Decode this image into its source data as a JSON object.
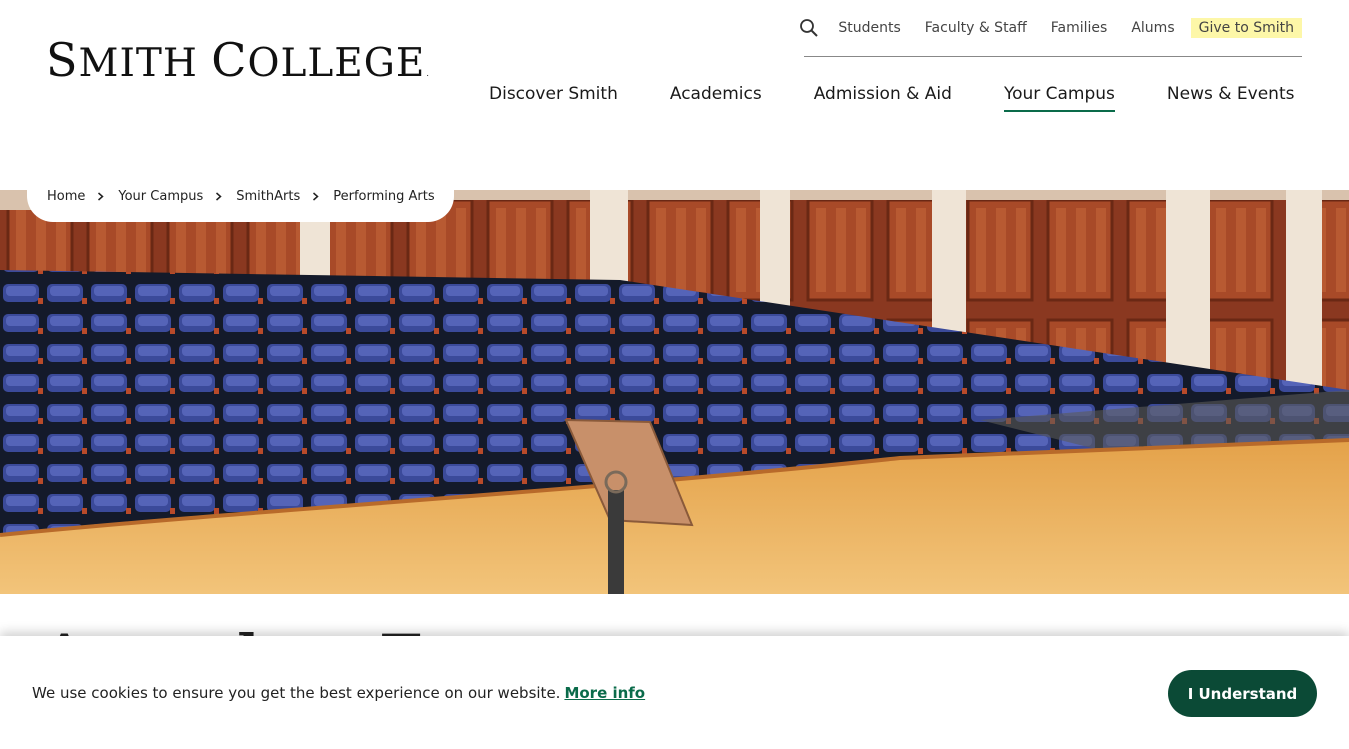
{
  "logo": {
    "first_initial": "S",
    "first_rest": "MITH",
    "second_initial": "C",
    "second_rest": "OLLEGE",
    "trademark": "."
  },
  "utility_nav": {
    "search_icon": "search-icon",
    "items": [
      "Students",
      "Faculty & Staff",
      "Families",
      "Alums"
    ],
    "give_label": "Give to Smith"
  },
  "main_nav": {
    "items": [
      "Discover Smith",
      "Academics",
      "Admission & Aid",
      "Your Campus",
      "News & Events"
    ],
    "active": "Your Campus"
  },
  "breadcrumb": [
    "Home",
    "Your Campus",
    "SmithArts",
    "Performing Arts"
  ],
  "page_title": "Attend an Event",
  "cookie_banner": {
    "message": "We use cookies to ensure you get the best experience on our website.",
    "more_info": "More info",
    "button": "I Understand"
  },
  "colors": {
    "accent": "#0a6b4a",
    "button": "#0b4a36",
    "give_highlight": "#fdf7a8"
  }
}
